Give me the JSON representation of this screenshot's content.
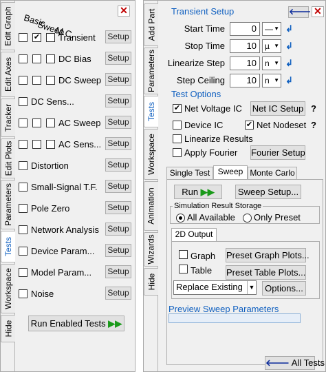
{
  "left": {
    "tabs": [
      "Edit Graph",
      "Edit Axes",
      "Tracker",
      "Edit Plots",
      "Parameters",
      "Tests",
      "Workspace",
      "Hide"
    ],
    "active_tab": "Tests",
    "headers": {
      "basic": "Basic",
      "sweep": "Sweep",
      "mc": "M.C."
    },
    "close": "✕",
    "analyses": [
      {
        "label": "Transient",
        "basic": false,
        "sweep": true,
        "mc": false,
        "three": true,
        "setup": "Setup"
      },
      {
        "label": "DC Bias",
        "basic": false,
        "sweep": false,
        "mc": false,
        "three": true,
        "setup": "Setup"
      },
      {
        "label": "DC Sweep",
        "basic": false,
        "sweep": false,
        "mc": false,
        "three": true,
        "setup": "Setup"
      },
      {
        "label": "DC Sens...",
        "basic": false,
        "three": false,
        "setup": "Setup"
      },
      {
        "label": "AC Sweep",
        "basic": false,
        "sweep": false,
        "mc": false,
        "three": true,
        "setup": "Setup"
      },
      {
        "label": "AC Sens...",
        "basic": false,
        "sweep": false,
        "mc": false,
        "three": true,
        "setup": "Setup"
      },
      {
        "label": "Distortion",
        "basic": false,
        "three": false,
        "setup": "Setup"
      },
      {
        "label": "Small-Signal T.F.",
        "basic": false,
        "three": false,
        "setup": "Setup"
      },
      {
        "label": "Pole Zero",
        "basic": false,
        "three": false,
        "setup": "Setup"
      },
      {
        "label": "Network  Analysis",
        "basic": false,
        "three": false,
        "setup": "Setup"
      },
      {
        "label": "Device Param...",
        "basic": false,
        "three": false,
        "setup": "Setup"
      },
      {
        "label": "Model  Param...",
        "basic": false,
        "three": false,
        "setup": "Setup"
      },
      {
        "label": "Noise",
        "basic": false,
        "three": false,
        "setup": "Setup"
      }
    ],
    "run_button": "Run Enabled Tests"
  },
  "right": {
    "tabs": [
      "Add Part",
      "Parameters",
      "Tests",
      "Workspace",
      "Animation",
      "Wizards",
      "Hide"
    ],
    "active_tab": "Tests",
    "transient_title": "Transient Setup",
    "fields": [
      {
        "label": "Start Time",
        "value": "0",
        "unit": "—"
      },
      {
        "label": "Stop Time",
        "value": "10",
        "unit": "µ"
      },
      {
        "label": "Linearize Step",
        "value": "10",
        "unit": "n"
      },
      {
        "label": "Step Ceiling",
        "value": "10",
        "unit": "n"
      }
    ],
    "test_options_title": "Test Options",
    "net_voltage_ic": "Net Voltage IC",
    "net_ic_setup": "Net IC Setup",
    "device_ic": "Device IC",
    "net_nodeset": "Net Nodeset",
    "linearize_results": "Linearize Results",
    "apply_fourier": "Apply Fourier",
    "fourier_setup": "Fourier Setup",
    "question": "?",
    "subtabs": [
      "Single Test",
      "Sweep",
      "Monte Carlo"
    ],
    "active_subtab": "Sweep",
    "run": "Run",
    "sweep_setup": "Sweep Setup...",
    "storage_title": "Simulation Result Storage",
    "all_available": "All Available",
    "only_preset": "Only Preset",
    "output_tab": "2D Output",
    "graph": "Graph",
    "table": "Table",
    "preset_graph": "Preset Graph Plots...",
    "preset_table": "Preset Table Plots...",
    "replace": "Replace Existing",
    "options": "Options...",
    "preview_title": "Preview Sweep Parameters",
    "all_tests": "All Tests"
  }
}
